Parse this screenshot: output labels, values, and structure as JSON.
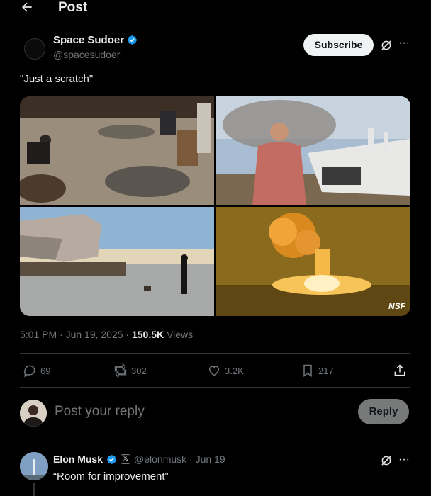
{
  "header": {
    "title": "Post",
    "back_icon": "arrow-left-icon"
  },
  "author": {
    "name": "Space Sudoer",
    "handle": "@spacesudoer",
    "subscribe_label": "Subscribe",
    "verified_color": "#1d9bf0"
  },
  "post": {
    "text": "\"Just a scratch\"",
    "media": [
      {
        "description": "workers sorting scrap debris"
      },
      {
        "description": "man in plaid shirt near wreckage"
      },
      {
        "description": "crumpled steel on launch pad"
      },
      {
        "description": "fireball explosion at night"
      }
    ],
    "watermark": "NSF"
  },
  "meta": {
    "time": "5:01 PM · Jun 19, 2025 · ",
    "views_count": "150.5K",
    "views_label": " Views"
  },
  "actions": {
    "replies": "69",
    "reposts": "302",
    "likes": "3.2K",
    "bookmarks": "217"
  },
  "reply_composer": {
    "placeholder": "Post your reply",
    "button_label": "Reply"
  },
  "reply": {
    "name": "Elon Musk",
    "badge": "𝕏",
    "handle": "@elonmusk · Jun 19",
    "text": "“Room for improvement”"
  }
}
